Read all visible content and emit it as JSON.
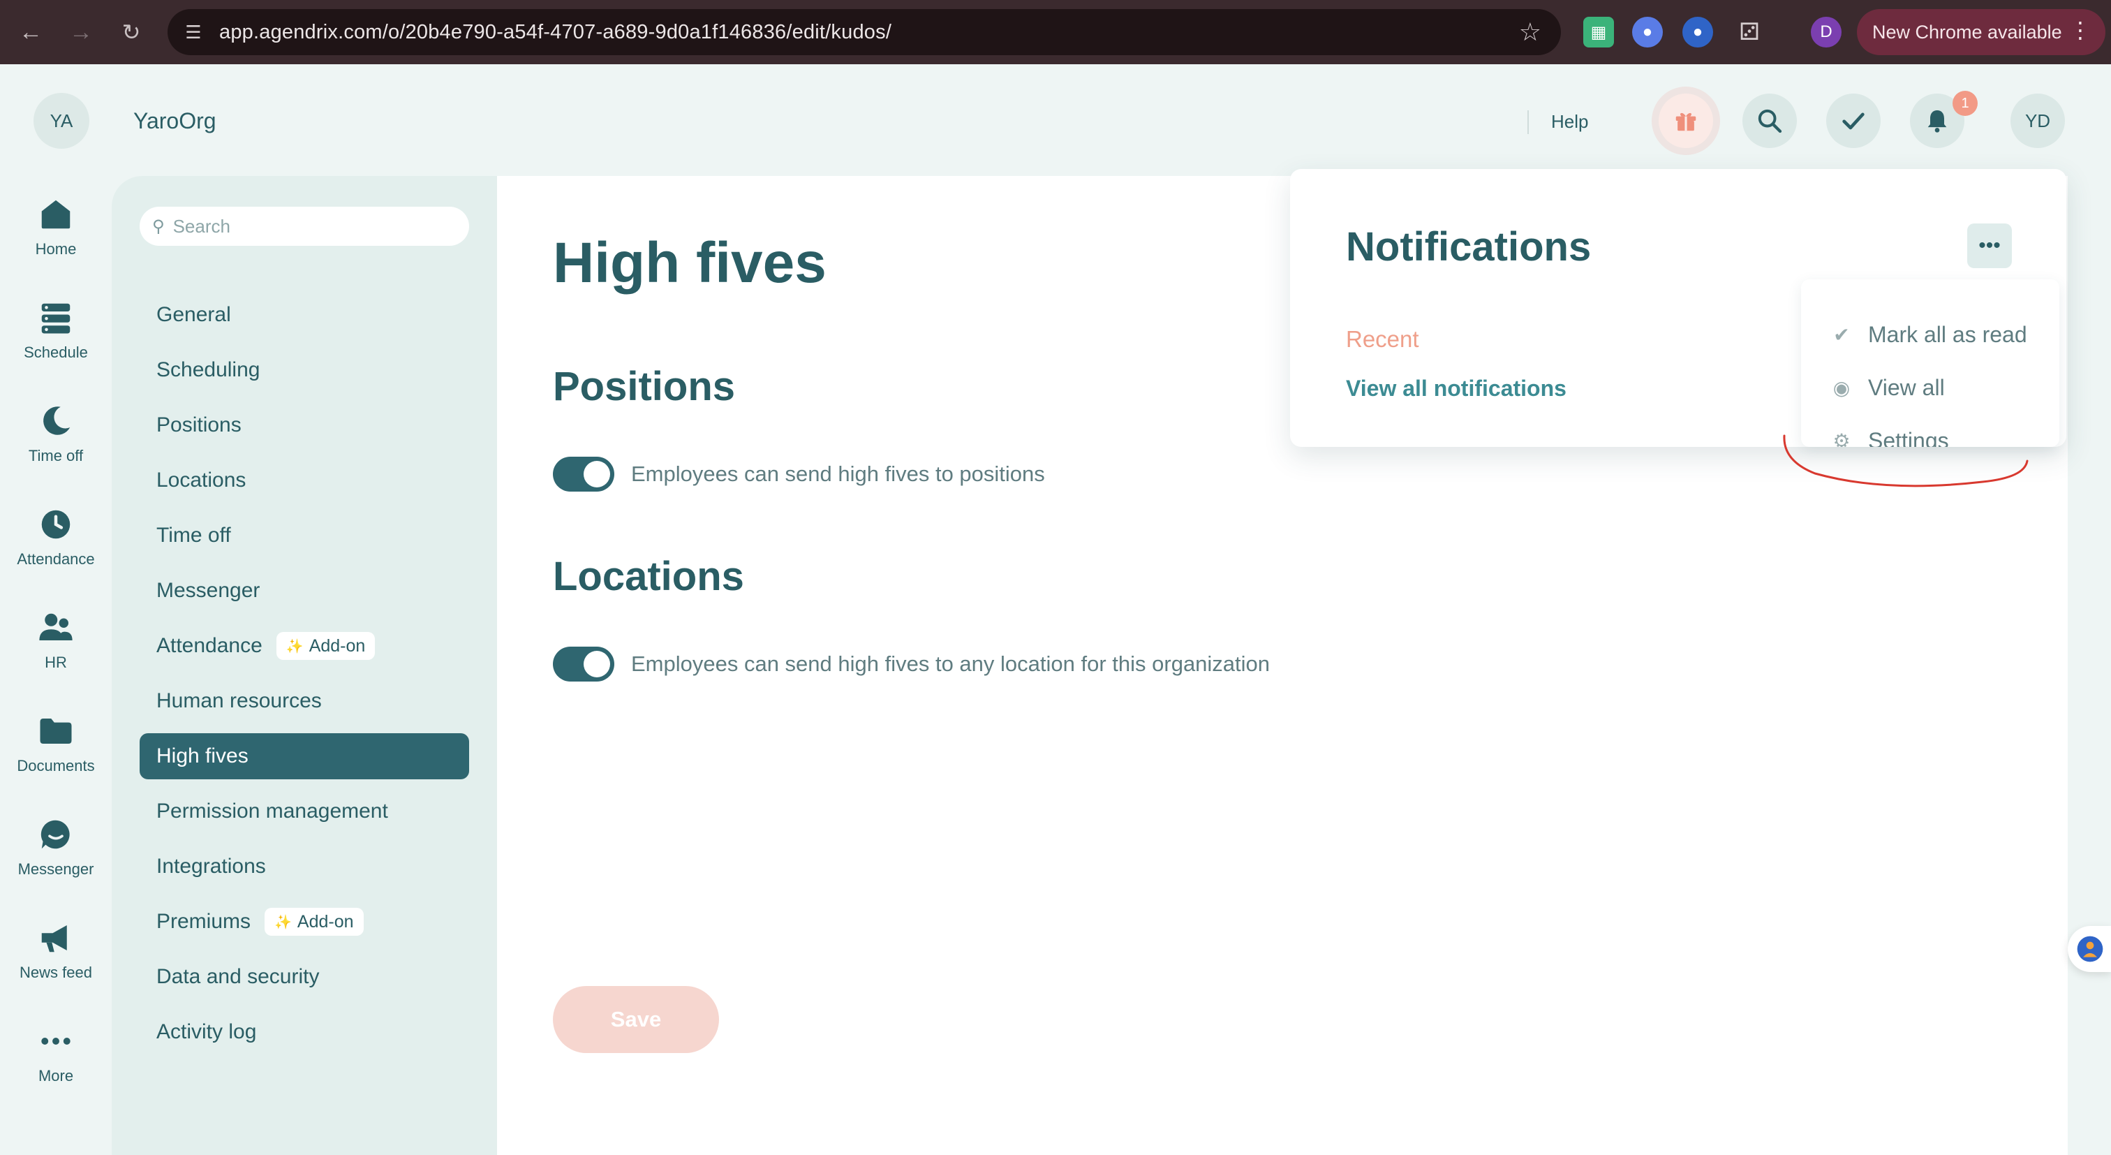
{
  "browser": {
    "url": "app.agendrix.com/o/20b4e790-a54f-4707-a689-9d0a1f146836/edit/kudos/",
    "profile_initial": "D",
    "update_label": "New Chrome available"
  },
  "header": {
    "org_initials": "YA",
    "org_name": "YaroOrg",
    "help_label": "Help",
    "notification_count": "1",
    "user_initials": "YD"
  },
  "rail": {
    "home": "Home",
    "schedule": "Schedule",
    "time_off": "Time off",
    "attendance": "Attendance",
    "hr": "HR",
    "documents": "Documents",
    "messenger": "Messenger",
    "news_feed": "News feed",
    "more": "More"
  },
  "settings_nav": {
    "search_placeholder": "Search",
    "addon_label": "Add-on",
    "items": [
      {
        "label": "General"
      },
      {
        "label": "Scheduling"
      },
      {
        "label": "Positions"
      },
      {
        "label": "Locations"
      },
      {
        "label": "Time off"
      },
      {
        "label": "Messenger"
      },
      {
        "label": "Attendance"
      },
      {
        "label": "Human resources"
      },
      {
        "label": "High fives"
      },
      {
        "label": "Permission management"
      },
      {
        "label": "Integrations"
      },
      {
        "label": "Premiums"
      },
      {
        "label": "Data and security"
      },
      {
        "label": "Activity log"
      }
    ]
  },
  "main": {
    "title": "High fives",
    "sections": [
      {
        "title": "Positions",
        "toggle_label": "Employees can send high fives to positions",
        "enabled": true
      },
      {
        "title": "Locations",
        "toggle_label": "Employees can send high fives to any location for this organization",
        "enabled": true
      }
    ],
    "save_label": "Save"
  },
  "notifications": {
    "title": "Notifications",
    "recent_label": "Recent",
    "view_all_label": "View all notifications",
    "menu": {
      "mark_all_read": "Mark all as read",
      "view_all": "View all",
      "settings": "Settings"
    }
  },
  "colors": {
    "primary": "#2f6670",
    "accent": "#ef9f8a",
    "link": "#3c8b93",
    "background": "#eef5f4"
  }
}
